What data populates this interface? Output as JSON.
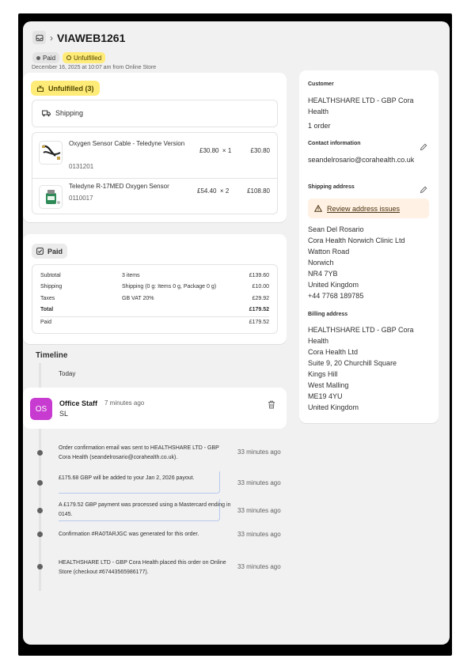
{
  "order": {
    "breadcrumb_sep": "›",
    "title": "VIAWEB1261",
    "badge_paid": "Paid",
    "badge_unfulfilled": "Unfulfilled",
    "date": "December 16, 2025 at 10:07 am from Online Store"
  },
  "fulfillment": {
    "badge": "Unfulfilled (3)",
    "method": "Shipping",
    "items": [
      {
        "name": "Oxygen Sensor Cable - Teledyne Version",
        "sku": "0131201",
        "price": "£30.80",
        "qty": "× 1",
        "total": "£30.80"
      },
      {
        "name": "Teledyne R-17MED Oxygen Sensor",
        "sku": "0110017",
        "price": "£54.40",
        "qty": "× 2",
        "total": "£108.80"
      }
    ]
  },
  "payment": {
    "badge": "Paid",
    "rows": [
      {
        "label": "Subtotal",
        "detail": "3 items",
        "amount": "£139.60"
      },
      {
        "label": "Shipping",
        "detail": "Shipping (0 g: Items 0 g, Package 0 g)",
        "amount": "£10.00"
      },
      {
        "label": "Taxes",
        "detail": "GB VAT 20%",
        "amount": "£29.92"
      },
      {
        "label": "Total",
        "detail": "",
        "amount": "£179.52"
      },
      {
        "label": "Paid",
        "detail": "",
        "amount": "£179.52"
      }
    ]
  },
  "timeline": {
    "title": "Timeline",
    "today": "Today",
    "comment": {
      "initials": "OS",
      "author": "Office Staff",
      "time": "7 minutes ago",
      "text": "SL"
    },
    "events": [
      {
        "text": "Order confirmation email was sent to HEALTHSHARE LTD - GBP Cora Health (seandelrosario@corahealth.co.uk).",
        "time": "33 minutes ago"
      },
      {
        "text": "£175.68 GBP will be added to your Jan 2, 2026 payout.",
        "time": "33 minutes ago"
      },
      {
        "text": "A £179.52 GBP payment was processed using a Mastercard ending in 0145.",
        "time": "33 minutes ago"
      },
      {
        "text": "Confirmation #RA0TARJGC was generated for this order.",
        "time": "33 minutes ago"
      },
      {
        "text": "HEALTHSHARE LTD - GBP Cora Health placed this order on Online Store (checkout #67443565986177).",
        "time": "33 minutes ago"
      }
    ]
  },
  "customer": {
    "heading": "Customer",
    "name": "HEALTHSHARE LTD - GBP Cora Health",
    "orders": "1 order",
    "contact_heading": "Contact information",
    "email": "seandelrosario@corahealth.co.uk",
    "shipping_heading": "Shipping address",
    "review_link": "Review address issues",
    "shipping_lines": [
      "Sean Del Rosario",
      "Cora Health Norwich Clinic Ltd",
      "Watton Road",
      "Norwich",
      "NR4 7YB",
      "United Kingdom",
      "+44 7768 189785"
    ],
    "billing_heading": "Billing address",
    "billing_lines": [
      "HEALTHSHARE LTD - GBP Cora Health",
      "Cora Health Ltd",
      "Suite 9, 20 Churchill Square",
      "Kings Hill",
      "West Malling",
      "ME19 4YU",
      "United Kingdom"
    ]
  },
  "colors": {
    "unfulfilled": "#ffeb78",
    "avatar": "#c73bd0",
    "warning_bg": "#fff1e3"
  }
}
